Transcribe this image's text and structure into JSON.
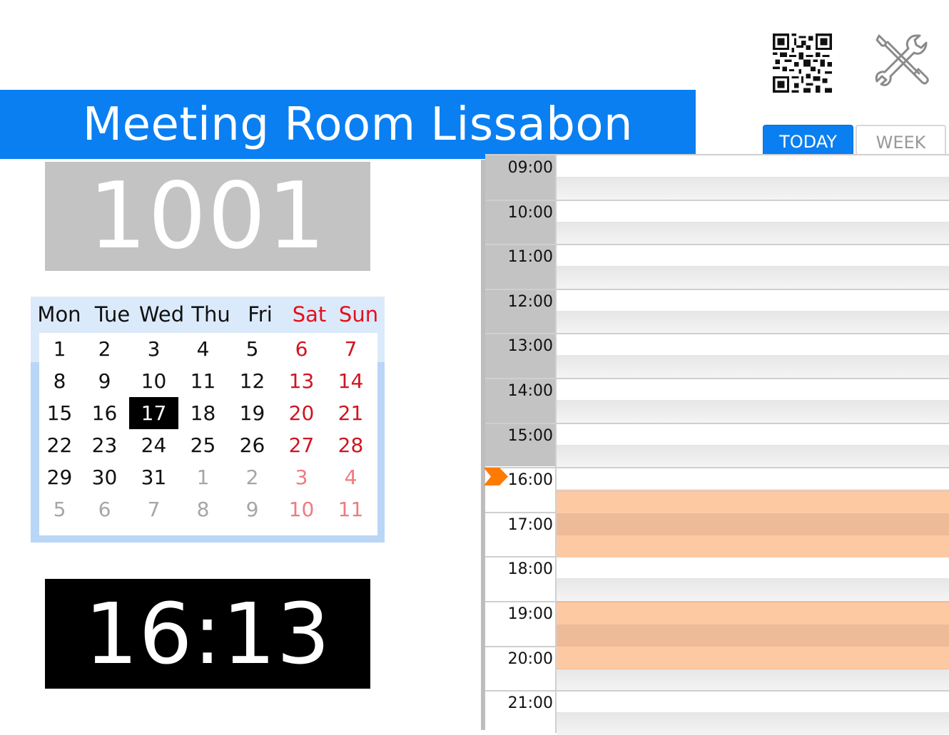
{
  "room": {
    "name": "Meeting Room Lissabon",
    "number": "1001"
  },
  "clock": {
    "time": "16:13"
  },
  "view_tabs": [
    {
      "label": "TODAY",
      "active": true
    },
    {
      "label": "WEEK",
      "active": false
    }
  ],
  "calendar": {
    "weekdays": [
      "Mon",
      "Tue",
      "Wed",
      "Thu",
      "Fri",
      "Sat",
      "Sun"
    ],
    "weeks": [
      [
        "1",
        "2",
        "3",
        "4",
        "5",
        "6",
        "7"
      ],
      [
        "8",
        "9",
        "10",
        "11",
        "12",
        "13",
        "14"
      ],
      [
        "15",
        "16",
        "17",
        "18",
        "19",
        "20",
        "21"
      ],
      [
        "22",
        "23",
        "24",
        "25",
        "26",
        "27",
        "28"
      ],
      [
        "29",
        "30",
        "31",
        "1",
        "2",
        "3",
        "4"
      ],
      [
        "5",
        "6",
        "7",
        "8",
        "9",
        "10",
        "11"
      ]
    ],
    "today": "17"
  },
  "schedule": {
    "hours": [
      "09:00",
      "10:00",
      "11:00",
      "12:00",
      "13:00",
      "14:00",
      "15:00",
      "16:00",
      "17:00",
      "18:00",
      "19:00",
      "20:00",
      "21:00"
    ],
    "current_time": "16:13",
    "bookings": [
      {
        "start": "16:30",
        "end": "18:00"
      },
      {
        "start": "19:00",
        "end": "20:30"
      }
    ]
  },
  "colors": {
    "accent": "#0a7ff2",
    "booking": "#fdc9a3",
    "weekend": "#e3101b",
    "now_marker": "#ff7a00"
  },
  "icons": {
    "qr": "qr-code-icon",
    "settings": "tools-icon"
  }
}
